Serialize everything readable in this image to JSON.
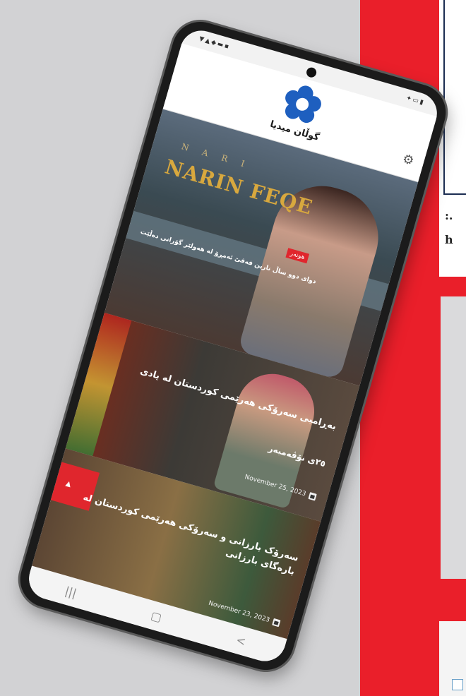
{
  "background": {
    "text_line1": ":.",
    "text_line2": "h"
  },
  "app": {
    "logo_text": "گوڵان میدیا",
    "status_left": "▼▲◆▬▪",
    "status_right": "✦▭▮"
  },
  "hero": {
    "brand_sub": "N A R I",
    "brand": "NARIN FEQE",
    "tag": "هونەر",
    "caption": "دوای دوو ساڵ نارین فەقێ ئەمڕۆ لە هەولێر گۆرانی دەڵێت"
  },
  "article1": {
    "title": "بەڕامبی سەرۆکی هەرێمی کوردستان لە یادی",
    "description": "٢٥ی نۆڤەمبەر",
    "date": "November 25, 2023"
  },
  "article2": {
    "title": "سەرۆک بارزانی و سەرۆکی هەرێمی کوردستان لە بارەگای بارزانی",
    "date": "November 23, 2023"
  },
  "nav": {
    "recent": "|||",
    "home": "▢",
    "back": "<"
  },
  "colors": {
    "accent_red": "#ea1f2a",
    "logo_blue": "#1e5fbf",
    "brand_gold": "#d8a83e"
  }
}
